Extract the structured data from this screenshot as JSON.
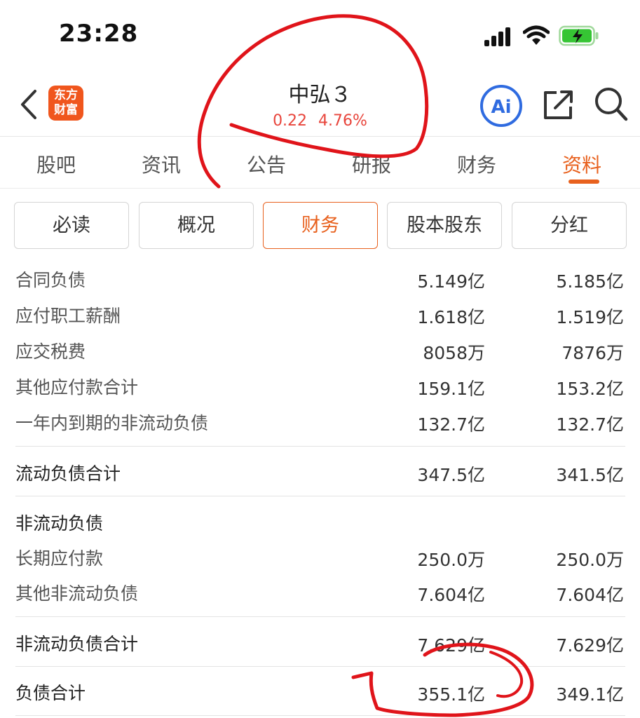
{
  "status_bar": {
    "time": "23:28"
  },
  "header": {
    "logo_line1": "东方",
    "logo_line2": "财富",
    "title": "中弘３",
    "change": "0.22",
    "change_pct": "4.76%",
    "quote_color": "#e8453c",
    "ai_label": "Ai"
  },
  "tabs": [
    {
      "label": "股吧"
    },
    {
      "label": "资讯"
    },
    {
      "label": "公告"
    },
    {
      "label": "研报"
    },
    {
      "label": "财务"
    },
    {
      "label": "资料",
      "active": true
    }
  ],
  "subtabs": [
    {
      "label": "必读"
    },
    {
      "label": "概况"
    },
    {
      "label": "财务",
      "active": true
    },
    {
      "label": "股本股东"
    },
    {
      "label": "分红"
    }
  ],
  "accent_color": "#e8611e",
  "table": {
    "group1": [
      {
        "label": "合同负债",
        "v1": "5.149亿",
        "v2": "5.185亿"
      },
      {
        "label": "应付职工薪酬",
        "v1": "1.618亿",
        "v2": "1.519亿"
      },
      {
        "label": "应交税费",
        "v1": "8058万",
        "v2": "7876万"
      },
      {
        "label": "其他应付款合计",
        "v1": "159.1亿",
        "v2": "153.2亿"
      },
      {
        "label": "一年内到期的非流动负债",
        "v1": "132.7亿",
        "v2": "132.7亿"
      }
    ],
    "current_total": {
      "label": "流动负债合计",
      "v1": "347.5亿",
      "v2": "341.5亿"
    },
    "noncurrent_heading": "非流动负债",
    "group2": [
      {
        "label": "长期应付款",
        "v1": "250.0万",
        "v2": "250.0万"
      },
      {
        "label": "其他非流动负债",
        "v1": "7.604亿",
        "v2": "7.604亿"
      }
    ],
    "noncurrent_total": {
      "label": "非流动负债合计",
      "v1": "7.629亿",
      "v2": "7.629亿"
    },
    "liabilities_total": {
      "label": "负债合计",
      "v1": "355.1亿",
      "v2": "349.1亿"
    }
  },
  "annotation_color": "#e0141a"
}
